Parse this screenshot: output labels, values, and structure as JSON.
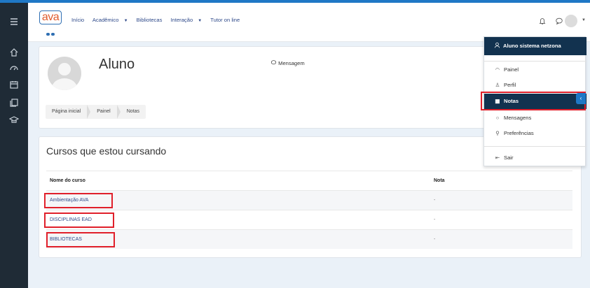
{
  "nav": {
    "logo_text": "ava",
    "items": [
      {
        "label": "Início",
        "caret": ""
      },
      {
        "label": "Acadêmico",
        "caret": "▼"
      },
      {
        "label": "Bibliotecas",
        "caret": ""
      },
      {
        "label": "Interação",
        "caret": "▼"
      },
      {
        "label": "Tutor on line",
        "caret": ""
      }
    ]
  },
  "sidebar": {
    "icons": [
      "menu-icon",
      "home-icon",
      "dashboard-icon",
      "calendar-icon",
      "files-icon",
      "courses-icon"
    ]
  },
  "profile": {
    "name": "Aluno",
    "message_label": "Mensagem"
  },
  "breadcrumb": [
    "Página inicial",
    "Painel",
    "Notas"
  ],
  "courses": {
    "title": "Cursos que estou cursando",
    "columns": [
      "Nome do curso",
      "Nota"
    ],
    "rows": [
      {
        "name": "Ambientação AVA",
        "grade": "-"
      },
      {
        "name": "DISCIPLINAS EAD",
        "grade": "-"
      },
      {
        "name": "BIBLIOTECAS",
        "grade": "-"
      }
    ]
  },
  "user_menu": {
    "header": "Aluno sistema netzona",
    "items": [
      {
        "icon": "dashboard-icon",
        "label": "Painel"
      },
      {
        "icon": "user-icon",
        "label": "Perfil"
      },
      {
        "icon": "grades-icon",
        "label": "Notas",
        "active": true
      },
      {
        "icon": "message-icon",
        "label": "Mensagens"
      },
      {
        "icon": "wrench-icon",
        "label": "Preferências"
      },
      {
        "icon": "logout-icon",
        "label": "Sair"
      }
    ]
  },
  "colors": {
    "frame_blue": "#1f78c6",
    "sidebar": "#1f2b36",
    "menu_dark": "#12324f",
    "highlight_red": "#e01f2a",
    "link": "#2f4a8a"
  }
}
